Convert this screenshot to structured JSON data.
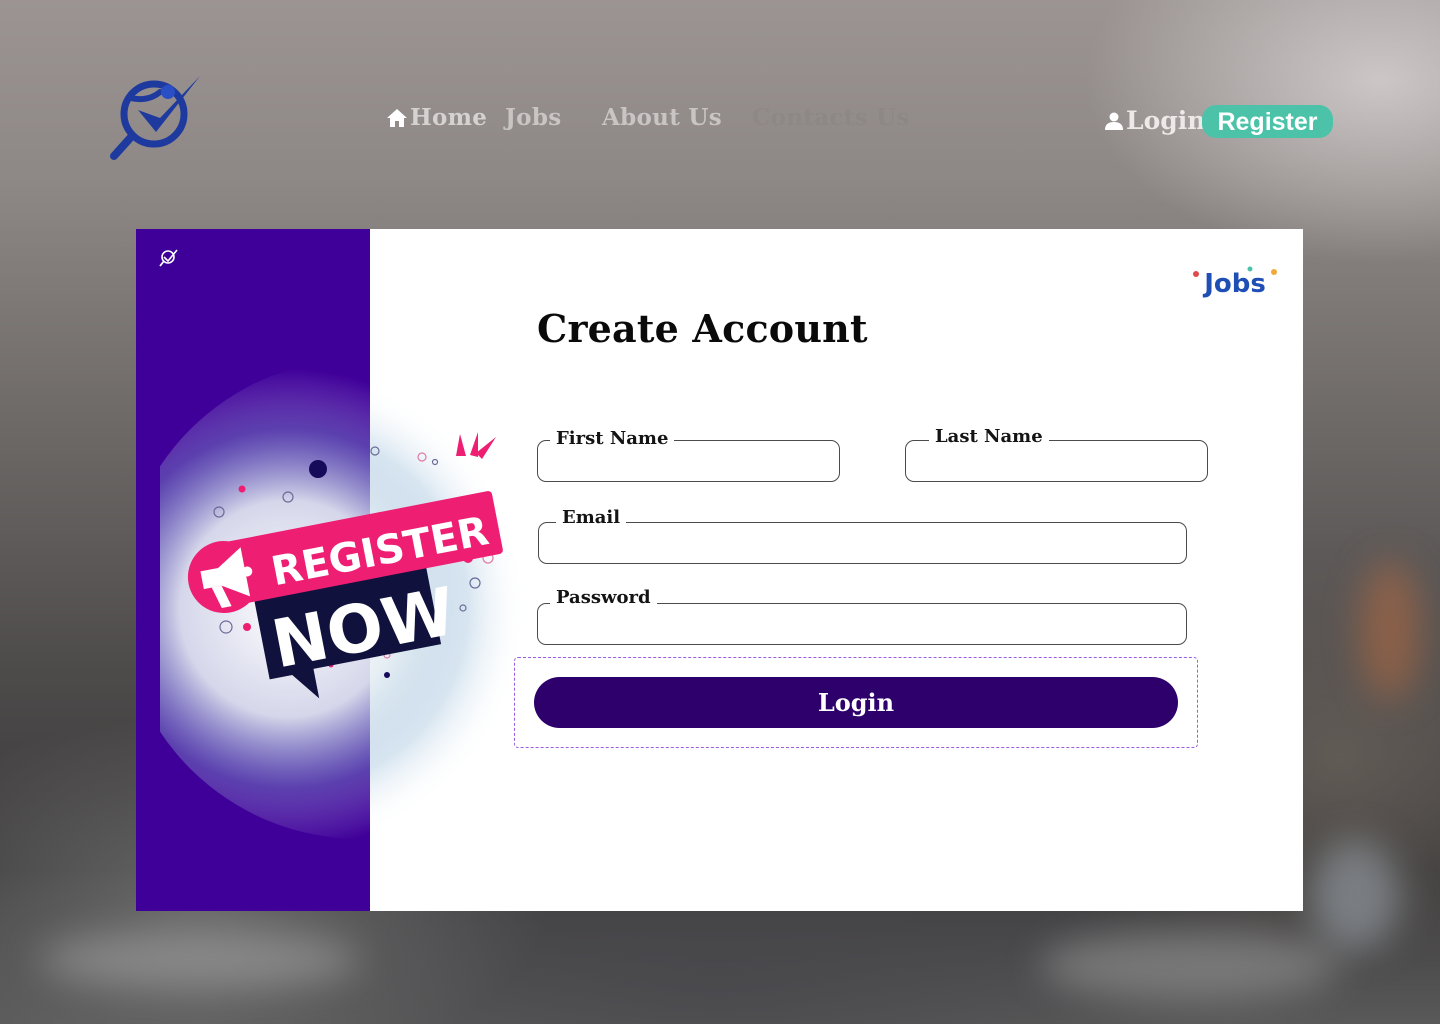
{
  "header": {
    "nav": [
      {
        "label": "Home",
        "icon": "home-icon"
      },
      {
        "label": "Jobs"
      },
      {
        "label": "About Us"
      },
      {
        "label": "Contacts Us"
      }
    ],
    "login_label": "Login",
    "register_label": "Register"
  },
  "card": {
    "promo_line1": "REGISTER",
    "promo_line2": "NOW",
    "title": "Create Account",
    "fields": {
      "first_name": {
        "label": "First Name",
        "value": ""
      },
      "last_name": {
        "label": "Last Name",
        "value": ""
      },
      "email": {
        "label": "Email",
        "value": ""
      },
      "password": {
        "label": "Password",
        "value": ""
      }
    },
    "submit_label": "Login",
    "jobs_logo_text": "Jobs"
  },
  "colors": {
    "primary": "#3f0099",
    "button": "#2e006c",
    "accent": "#4cc3a8",
    "promo_pink": "#ee1e73",
    "promo_navy": "#10123d"
  }
}
